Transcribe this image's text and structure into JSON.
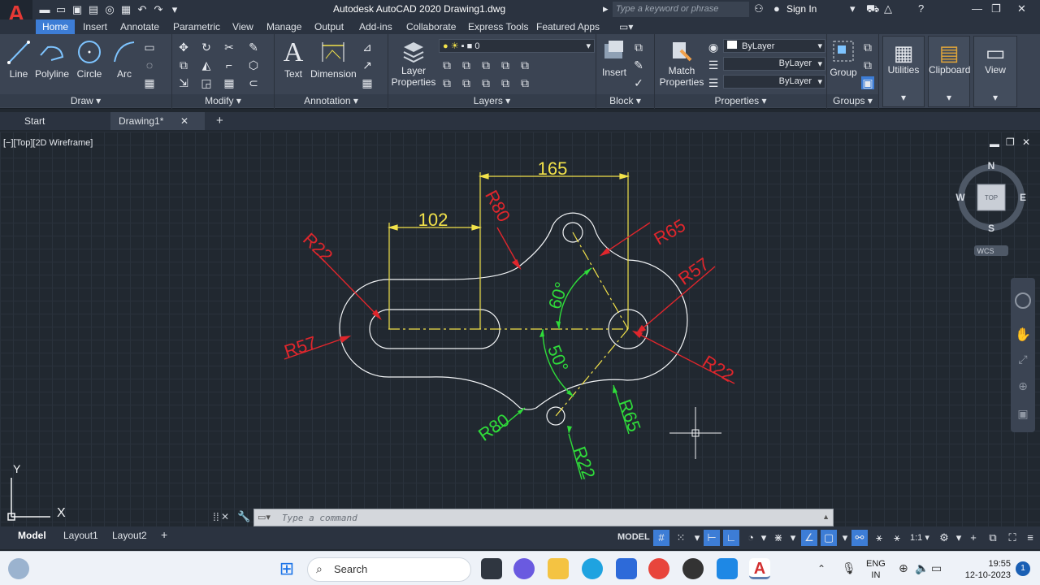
{
  "window": {
    "title": "Autodesk AutoCAD 2020   Drawing1.dwg",
    "search_placeholder": "Type a keyword or phrase",
    "sign_in": "Sign In"
  },
  "ribbon_tabs": [
    "Home",
    "Insert",
    "Annotate",
    "Parametric",
    "View",
    "Manage",
    "Output",
    "Add-ins",
    "Collaborate",
    "Express Tools",
    "Featured Apps"
  ],
  "ribbon": {
    "draw": {
      "label": "Draw",
      "tools": [
        "Line",
        "Polyline",
        "Circle",
        "Arc"
      ]
    },
    "modify": {
      "label": "Modify"
    },
    "annotation": {
      "label": "Annotation",
      "text": "Text",
      "dimension": "Dimension"
    },
    "layers": {
      "label": "Layers",
      "layer_properties_1": "Layer",
      "layer_properties_2": "Properties",
      "current_layer": "0"
    },
    "block": {
      "label": "Block",
      "insert": "Insert"
    },
    "properties": {
      "label": "Properties",
      "match_1": "Match",
      "match_2": "Properties",
      "color": "ByLayer",
      "linetype": "ByLayer",
      "lineweight": "ByLayer"
    },
    "groups": {
      "label": "Groups",
      "group": "Group"
    },
    "utilities": "Utilities",
    "clipboard": "Clipboard",
    "view": "View"
  },
  "file_tabs": [
    "Start",
    "Drawing1*"
  ],
  "viewport": {
    "label": "[−][Top][2D Wireframe]",
    "viewcube": {
      "n": "N",
      "s": "S",
      "e": "E",
      "w": "W",
      "face": "TOP",
      "ucs": "WCS"
    }
  },
  "dimensions": {
    "d165": "165",
    "d102": "102",
    "r80_top": "R80",
    "r65_right": "R65",
    "r57_right": "R57",
    "r22_right": "R22",
    "r22_left": "R22",
    "r57_left": "R57",
    "a60": "60°",
    "a50": "50°",
    "r80_bottom": "R80",
    "r22_bottom": "R22",
    "r65_bottom": "R65"
  },
  "ucs_icon": {
    "x": "X",
    "y": "Y"
  },
  "command_line": {
    "placeholder": "Type a command"
  },
  "layout_tabs": [
    "Model",
    "Layout1",
    "Layout2"
  ],
  "status_bar": {
    "model": "MODEL",
    "scale": "1:1"
  },
  "taskbar": {
    "search": "Search",
    "lang_1": "ENG",
    "lang_2": "IN",
    "time": "19:55",
    "date": "12-10-2023",
    "notification_count": "1"
  },
  "colors": {
    "dim_yellow": "#f2e24a",
    "dim_red": "#e0262c",
    "dim_green": "#2fdc3a",
    "geometry": "#f2f4f6",
    "accent": "#3d7dd6"
  }
}
